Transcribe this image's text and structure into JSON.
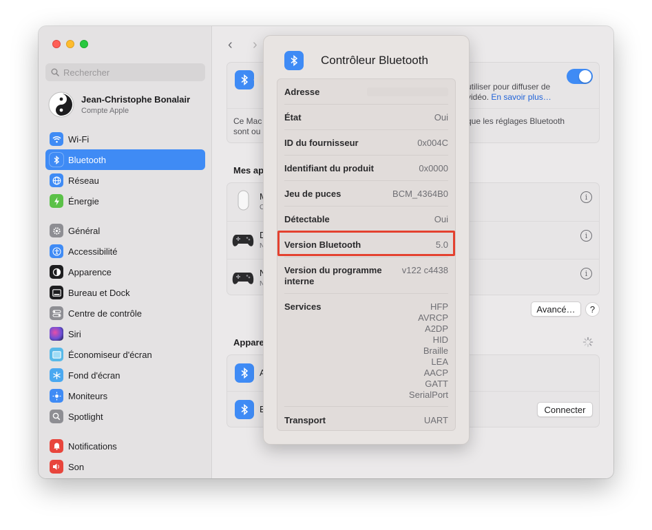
{
  "sidebar": {
    "search_placeholder": "Rechercher",
    "account": {
      "name": "Jean-Christophe Bonalair",
      "subtitle": "Compte Apple"
    },
    "group1": [
      {
        "label": "Wi-Fi",
        "icon": "wifi-icon",
        "color": "#3f8bf5",
        "active": false
      },
      {
        "label": "Bluetooth",
        "icon": "bluetooth-icon",
        "color": "#3f8bf5",
        "active": true
      },
      {
        "label": "Réseau",
        "icon": "globe-icon",
        "color": "#3f8bf5",
        "active": false
      },
      {
        "label": "Énergie",
        "icon": "battery-icon",
        "color": "#5bc148",
        "active": false
      }
    ],
    "group2": [
      {
        "label": "Général",
        "icon": "gear-icon",
        "color": "#8e8e93"
      },
      {
        "label": "Accessibilité",
        "icon": "accessibility-icon",
        "color": "#3f8bf5"
      },
      {
        "label": "Apparence",
        "icon": "appearance-icon",
        "color": "#1d1d1f"
      },
      {
        "label": "Bureau et Dock",
        "icon": "dock-icon",
        "color": "#1d1d1f"
      },
      {
        "label": "Centre de contrôle",
        "icon": "control-center-icon",
        "color": "#8e8e93"
      },
      {
        "label": "Siri",
        "icon": "siri-icon",
        "color": "#6b4fd6"
      },
      {
        "label": "Économiseur d'écran",
        "icon": "screensaver-icon",
        "color": "#58b9e8"
      },
      {
        "label": "Fond d'écran",
        "icon": "wallpaper-icon",
        "color": "#4aa8f0"
      },
      {
        "label": "Moniteurs",
        "icon": "display-icon",
        "color": "#3f8bf5"
      },
      {
        "label": "Spotlight",
        "icon": "spotlight-icon",
        "color": "#8e8e93"
      }
    ],
    "group3": [
      {
        "label": "Notifications",
        "icon": "bell-icon",
        "color": "#e8453c"
      },
      {
        "label": "Son",
        "icon": "speaker-icon",
        "color": "#e8453c"
      }
    ]
  },
  "main": {
    "back": "‹",
    "forward": "›",
    "bt_card": {
      "text_right_1": "utiliser pour diffuser de",
      "text_right_2": "vidéo.",
      "link": "En savoir plus…",
      "text_left_1": "Ce Mac",
      "text_left_2": "sont ou",
      "text_right_3": "que les réglages Bluetooth",
      "toggle_on": true
    },
    "my_devices_title": "Mes ap",
    "devices": [
      {
        "letter": "M",
        "sub": "C",
        "icon": "mouse-icon"
      },
      {
        "letter": "D",
        "sub": "N",
        "icon": "gamepad-icon"
      },
      {
        "letter": "N",
        "sub": "N",
        "icon": "gamepad-icon"
      }
    ],
    "advanced_button": "Avancé…",
    "help_button": "?",
    "nearby_title": "Appare",
    "nearby": [
      {
        "letter": "A",
        "icon": "bluetooth-icon"
      },
      {
        "letter": "B",
        "icon": "bluetooth-icon"
      }
    ],
    "connect_button": "Connecter"
  },
  "popover": {
    "title": "Contrôleur Bluetooth",
    "rows": {
      "address": {
        "key": "Adresse",
        "value": ""
      },
      "state": {
        "key": "État",
        "value": "Oui"
      },
      "vendor": {
        "key": "ID du fournisseur",
        "value": "0x004C"
      },
      "product": {
        "key": "Identifiant du produit",
        "value": "0x0000"
      },
      "chipset": {
        "key": "Jeu de puces",
        "value": "BCM_4364B0"
      },
      "discoverable": {
        "key": "Détectable",
        "value": "Oui"
      },
      "version": {
        "key": "Version Bluetooth",
        "value": "5.0"
      },
      "firmware": {
        "key_line1": "Version du programme",
        "key_line2": "interne",
        "value": "v122 c4438"
      },
      "services": {
        "key": "Services",
        "values": [
          "HFP",
          "AVRCP",
          "A2DP",
          "HID",
          "Braille",
          "LEA",
          "AACP",
          "GATT",
          "SerialPort"
        ]
      },
      "transport": {
        "key": "Transport",
        "value": "UART"
      }
    },
    "highlight_color": "#e4412f"
  }
}
